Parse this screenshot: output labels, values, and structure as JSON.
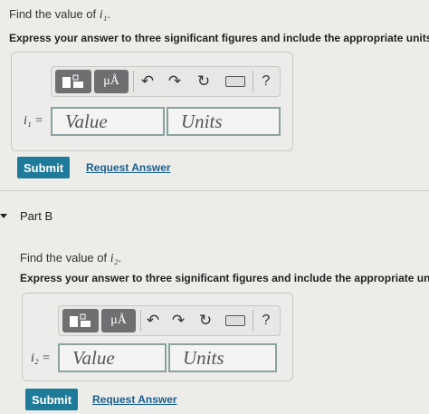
{
  "partA": {
    "prompt_prefix": "Find the value of",
    "var_symbol": "i₁",
    "prompt_suffix": ".",
    "instruction": "Express your answer to three significant figures and include the appropriate units.",
    "equation_label": "i₁ =",
    "value_placeholder": "Value",
    "units_placeholder": "Units",
    "toolbar": {
      "units_button": "μÅ",
      "help": "?"
    },
    "submit_label": "Submit",
    "request_answer_label": "Request Answer"
  },
  "partB": {
    "heading": "Part B",
    "prompt_prefix": "Find the value of",
    "var_symbol": "i₂",
    "prompt_suffix": ".",
    "instruction": "Express your answer to three significant figures and include the appropriate units.",
    "equation_label": "i₂ =",
    "value_placeholder": "Value",
    "units_placeholder": "Units",
    "toolbar": {
      "units_button": "μÅ",
      "help": "?"
    },
    "submit_label": "Submit",
    "request_answer_label": "Request Answer"
  },
  "colors": {
    "accent": "#1e7a99",
    "link": "#1c5f8f",
    "field_border": "#8aa3a0"
  },
  "icons": [
    "template-icon",
    "undo-icon",
    "redo-icon",
    "reset-icon",
    "keyboard-icon",
    "help-icon",
    "collapse-triangle-icon"
  ]
}
